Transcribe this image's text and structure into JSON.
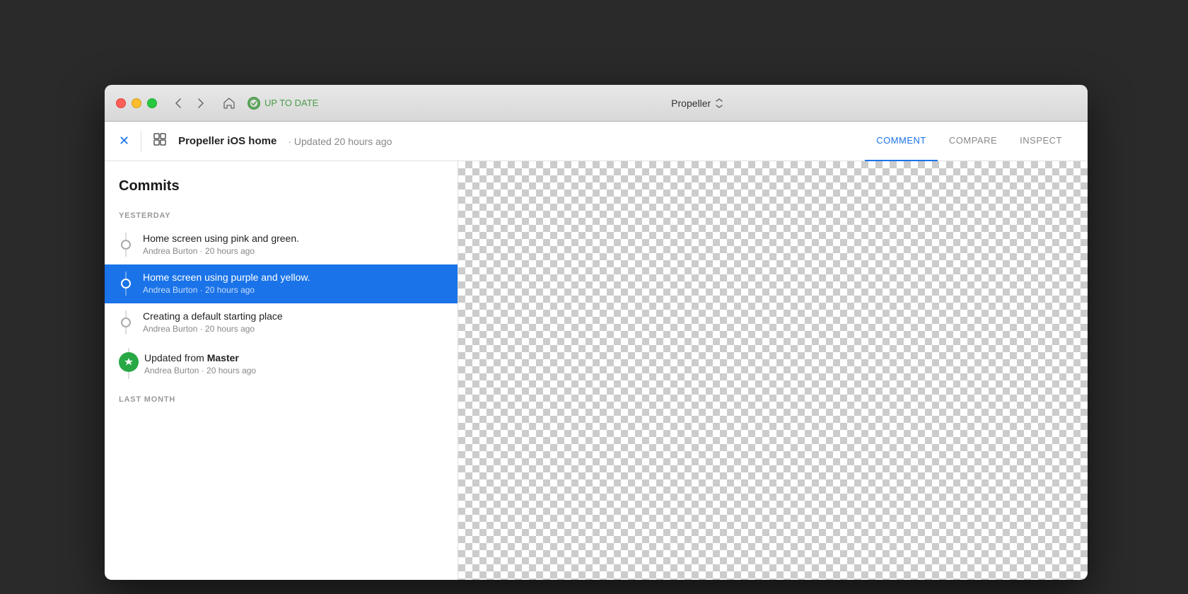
{
  "desktop": {
    "bg_color": "#2a2a2a"
  },
  "titlebar": {
    "traffic_lights": [
      "close",
      "minimize",
      "maximize"
    ],
    "nav_back": "‹",
    "nav_forward": "›",
    "home_icon": "⌂",
    "status_text": "UP TO DATE",
    "app_name": "Propeller",
    "app_arrow": "⌃⌄"
  },
  "toolbar": {
    "close_label": "×",
    "frame_icon": "⬚",
    "title": "Propeller iOS home",
    "subtitle": " · Updated 20 hours ago",
    "tabs": [
      {
        "label": "COMMENT",
        "active": true
      },
      {
        "label": "COMPARE",
        "active": false
      },
      {
        "label": "INSPECT",
        "active": false
      }
    ]
  },
  "sidebar": {
    "commits_heading": "Commits",
    "sections": [
      {
        "label": "YESTERDAY",
        "commits": [
          {
            "title": "Home screen using pink and green.",
            "author": "Andrea Burton",
            "time": "20 hours ago",
            "selected": false,
            "dot_type": "outline"
          },
          {
            "title": "Home screen using purple and yellow.",
            "author": "Andrea Burton",
            "time": "20 hours ago",
            "selected": true,
            "dot_type": "outline"
          },
          {
            "title": "Creating a default starting place",
            "author": "Andrea Burton",
            "time": "20 hours ago",
            "selected": false,
            "dot_type": "outline"
          },
          {
            "title": "Updated from Master",
            "author": "Andrea Burton",
            "time": "20 hours ago",
            "selected": false,
            "dot_type": "master",
            "title_bold": "Master"
          }
        ]
      },
      {
        "label": "LAST MONTH",
        "commits": []
      }
    ]
  },
  "canvas": {
    "checker_color1": "#cccccc",
    "checker_color2": "#ffffff"
  }
}
